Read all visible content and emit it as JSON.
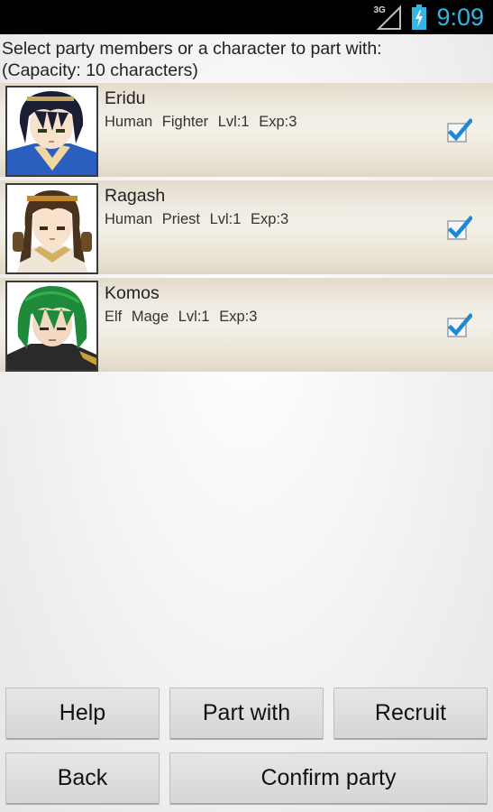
{
  "status_bar": {
    "network": "3G",
    "time": "9:09",
    "accent_color": "#33b5e5"
  },
  "instruction": {
    "line1": "Select party members or a character to part with:",
    "line2": "(Capacity: 10 characters)"
  },
  "party": [
    {
      "name": "Eridu",
      "race": "Human",
      "class": "Fighter",
      "level": "Lvl:1",
      "exp": "Exp:3",
      "checked": true,
      "portrait": "dark-haired-fighter-portrait"
    },
    {
      "name": "Ragash",
      "race": "Human",
      "class": "Priest",
      "level": "Lvl:1",
      "exp": "Exp:3",
      "checked": true,
      "portrait": "brown-haired-priest-portrait"
    },
    {
      "name": "Komos",
      "race": "Elf",
      "class": "Mage",
      "level": "Lvl:1",
      "exp": "Exp:3",
      "checked": true,
      "portrait": "green-haired-mage-portrait"
    }
  ],
  "buttons": {
    "help": "Help",
    "part_with": "Part with",
    "recruit": "Recruit",
    "back": "Back",
    "confirm": "Confirm party"
  }
}
